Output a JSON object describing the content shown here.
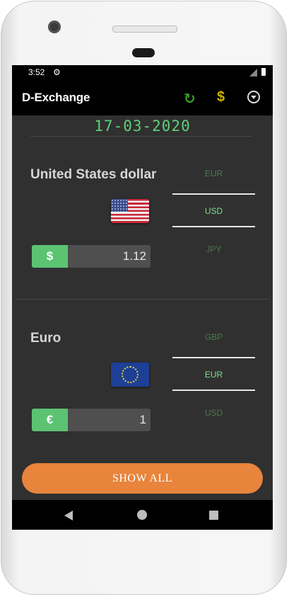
{
  "status_bar": {
    "time": "3:52"
  },
  "app_bar": {
    "title": "D-Exchange",
    "dollar_icon": "$"
  },
  "date": "17-03-2020",
  "top_currency": {
    "name": "United States dollar",
    "symbol": "$",
    "amount": "1.12",
    "picker": {
      "above": "EUR",
      "selected": "USD",
      "below": "JPY"
    }
  },
  "bottom_currency": {
    "name": "Euro",
    "symbol": "€",
    "amount": "1",
    "picker": {
      "above": "GBP",
      "selected": "EUR",
      "below": "USD"
    }
  },
  "show_all_label": "SHOW ALL",
  "colors": {
    "accent_green": "#5cc373",
    "button_orange": "#e8843c",
    "background": "#303030"
  }
}
